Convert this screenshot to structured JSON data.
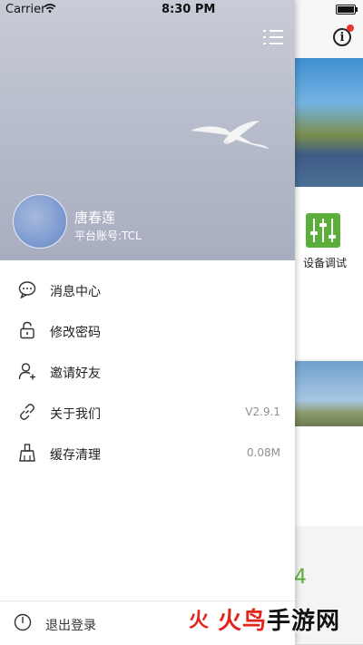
{
  "status_bar": {
    "carrier": "Carrier",
    "time": "8:30 PM"
  },
  "background_page": {
    "info_icon_glyph": "i",
    "device_label": "设备调试",
    "stat_number": "4"
  },
  "drawer": {
    "user": {
      "name": "唐春莲",
      "account": "平台账号:TCL"
    },
    "items": [
      {
        "icon": "message-icon",
        "label": "消息中心",
        "value": ""
      },
      {
        "icon": "lock-icon",
        "label": "修改密码",
        "value": ""
      },
      {
        "icon": "add-user-icon",
        "label": "邀请好友",
        "value": ""
      },
      {
        "icon": "link-icon",
        "label": "关于我们",
        "value": "V2.9.1"
      },
      {
        "icon": "broom-icon",
        "label": "缓存清理",
        "value": "0.08M"
      }
    ],
    "logout": {
      "icon": "power-icon",
      "label": "退出登录"
    }
  },
  "watermark": {
    "text_red": "火鸟",
    "text_black": "手游网",
    "icon_glyph": "火"
  },
  "colors": {
    "accent_green": "#5cae3a",
    "watermark_red": "#e2231a"
  }
}
